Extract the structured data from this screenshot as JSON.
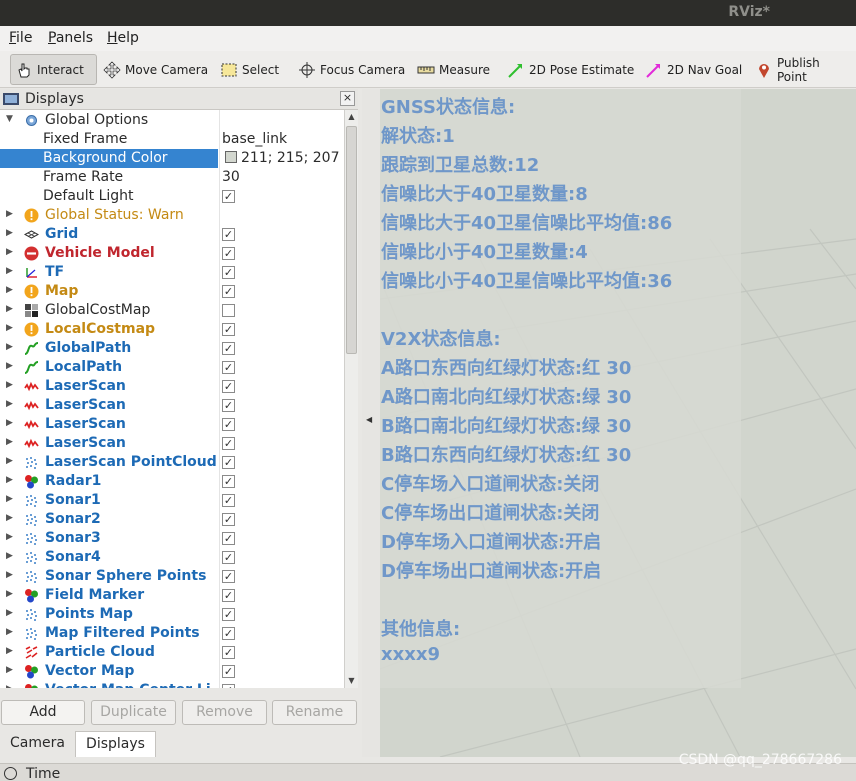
{
  "window": {
    "title": "RViz*"
  },
  "menu": [
    {
      "key": "F",
      "rest": "ile"
    },
    {
      "key": "P",
      "rest": "anels"
    },
    {
      "key": "H",
      "rest": "elp"
    }
  ],
  "toolbar": {
    "interact": "Interact",
    "move_camera": "Move Camera",
    "select": "Select",
    "focus_camera": "Focus Camera",
    "measure": "Measure",
    "pose_estimate": "2D Pose Estimate",
    "nav_goal": "2D Nav Goal",
    "publish_point": "Publish Point"
  },
  "displays_panel": {
    "title": "Displays",
    "close": "×",
    "global_options": {
      "label": "Global Options",
      "fixed_frame_label": "Fixed Frame",
      "fixed_frame_value": "base_link",
      "background_color_label": "Background Color",
      "background_color_value": "211; 215; 207",
      "frame_rate_label": "Frame Rate",
      "frame_rate_value": "30",
      "default_light_label": "Default Light"
    },
    "global_status": "Global Status: Warn",
    "items": [
      {
        "name": "Grid",
        "style": "blue",
        "icon": "grid-icon",
        "checked": true
      },
      {
        "name": "Vehicle Model",
        "style": "red",
        "icon": "error-icon",
        "checked": true
      },
      {
        "name": "TF",
        "style": "blue",
        "icon": "tf-icon",
        "checked": true
      },
      {
        "name": "Map",
        "style": "orange",
        "icon": "warning-icon",
        "checked": true
      },
      {
        "name": "GlobalCostMap",
        "style": "plain",
        "icon": "costmap-icon",
        "checked": false
      },
      {
        "name": "LocalCostmap",
        "style": "orange",
        "icon": "warning-icon",
        "checked": true
      },
      {
        "name": "GlobalPath",
        "style": "blue",
        "icon": "path-icon",
        "checked": true
      },
      {
        "name": "LocalPath",
        "style": "blue",
        "icon": "path-icon",
        "checked": true
      },
      {
        "name": "LaserScan",
        "style": "blue",
        "icon": "laserscan-icon",
        "checked": true
      },
      {
        "name": "LaserScan",
        "style": "blue",
        "icon": "laserscan-icon",
        "checked": true
      },
      {
        "name": "LaserScan",
        "style": "blue",
        "icon": "laserscan-icon",
        "checked": true
      },
      {
        "name": "LaserScan",
        "style": "blue",
        "icon": "laserscan-icon",
        "checked": true
      },
      {
        "name": "LaserScan PointCloud",
        "style": "blue",
        "icon": "pointcloud-icon",
        "checked": true
      },
      {
        "name": "Radar1",
        "style": "blue",
        "icon": "marker-icon",
        "checked": true
      },
      {
        "name": "Sonar1",
        "style": "blue",
        "icon": "pointcloud-icon",
        "checked": true
      },
      {
        "name": "Sonar2",
        "style": "blue",
        "icon": "pointcloud-icon",
        "checked": true
      },
      {
        "name": "Sonar3",
        "style": "blue",
        "icon": "pointcloud-icon",
        "checked": true
      },
      {
        "name": "Sonar4",
        "style": "blue",
        "icon": "pointcloud-icon",
        "checked": true
      },
      {
        "name": "Sonar Sphere Points",
        "style": "blue",
        "icon": "pointcloud-icon",
        "checked": true
      },
      {
        "name": "Field Marker",
        "style": "blue",
        "icon": "marker-icon",
        "checked": true
      },
      {
        "name": "Points Map",
        "style": "blue",
        "icon": "pointcloud-icon",
        "checked": true
      },
      {
        "name": "Map Filtered Points",
        "style": "blue",
        "icon": "pointcloud-icon",
        "checked": true
      },
      {
        "name": "Particle Cloud",
        "style": "blue",
        "icon": "particle-icon",
        "checked": true
      },
      {
        "name": "Vector Map",
        "style": "blue",
        "icon": "marker-icon",
        "checked": true
      },
      {
        "name": "Vector Map Center Li",
        "style": "blue",
        "icon": "marker-icon",
        "checked": true
      }
    ],
    "buttons": {
      "add": "Add",
      "duplicate": "Duplicate",
      "remove": "Remove",
      "rename": "Rename"
    },
    "tabs": {
      "camera": "Camera",
      "displays": "Displays"
    }
  },
  "overlay": {
    "lines": [
      "GNSS状态信息:",
      "解状态:1",
      "跟踪到卫星总数:12",
      "信噪比大于40卫星数量:8",
      "信噪比大于40卫星信噪比平均值:86",
      "信噪比小于40卫星数量:4",
      "信噪比小于40卫星信噪比平均值:36",
      "",
      "V2X状态信息:",
      "A路口东西向红绿灯状态:红 30",
      "A路口南北向红绿灯状态:绿 30",
      "B路口南北向红绿灯状态:绿 30",
      "B路口东西向红绿灯状态:红 30",
      "C停车场入口道闸状态:关闭",
      "C停车场出口道闸状态:关闭",
      "D停车场入口道闸状态:开启",
      "D停车场出口道闸状态:开启",
      "",
      "其他信息:",
      "xxxx9"
    ]
  },
  "statusbar": {
    "time_label": "Time"
  },
  "watermark": "CSDN @qq_278667286",
  "colors": {
    "accent_blue": "#1d6ab5",
    "error_red": "#c0262e",
    "warn_orange": "#c48a14",
    "overlay_text": "#6f97c9",
    "viewport_bg": "#d1d5cd"
  }
}
